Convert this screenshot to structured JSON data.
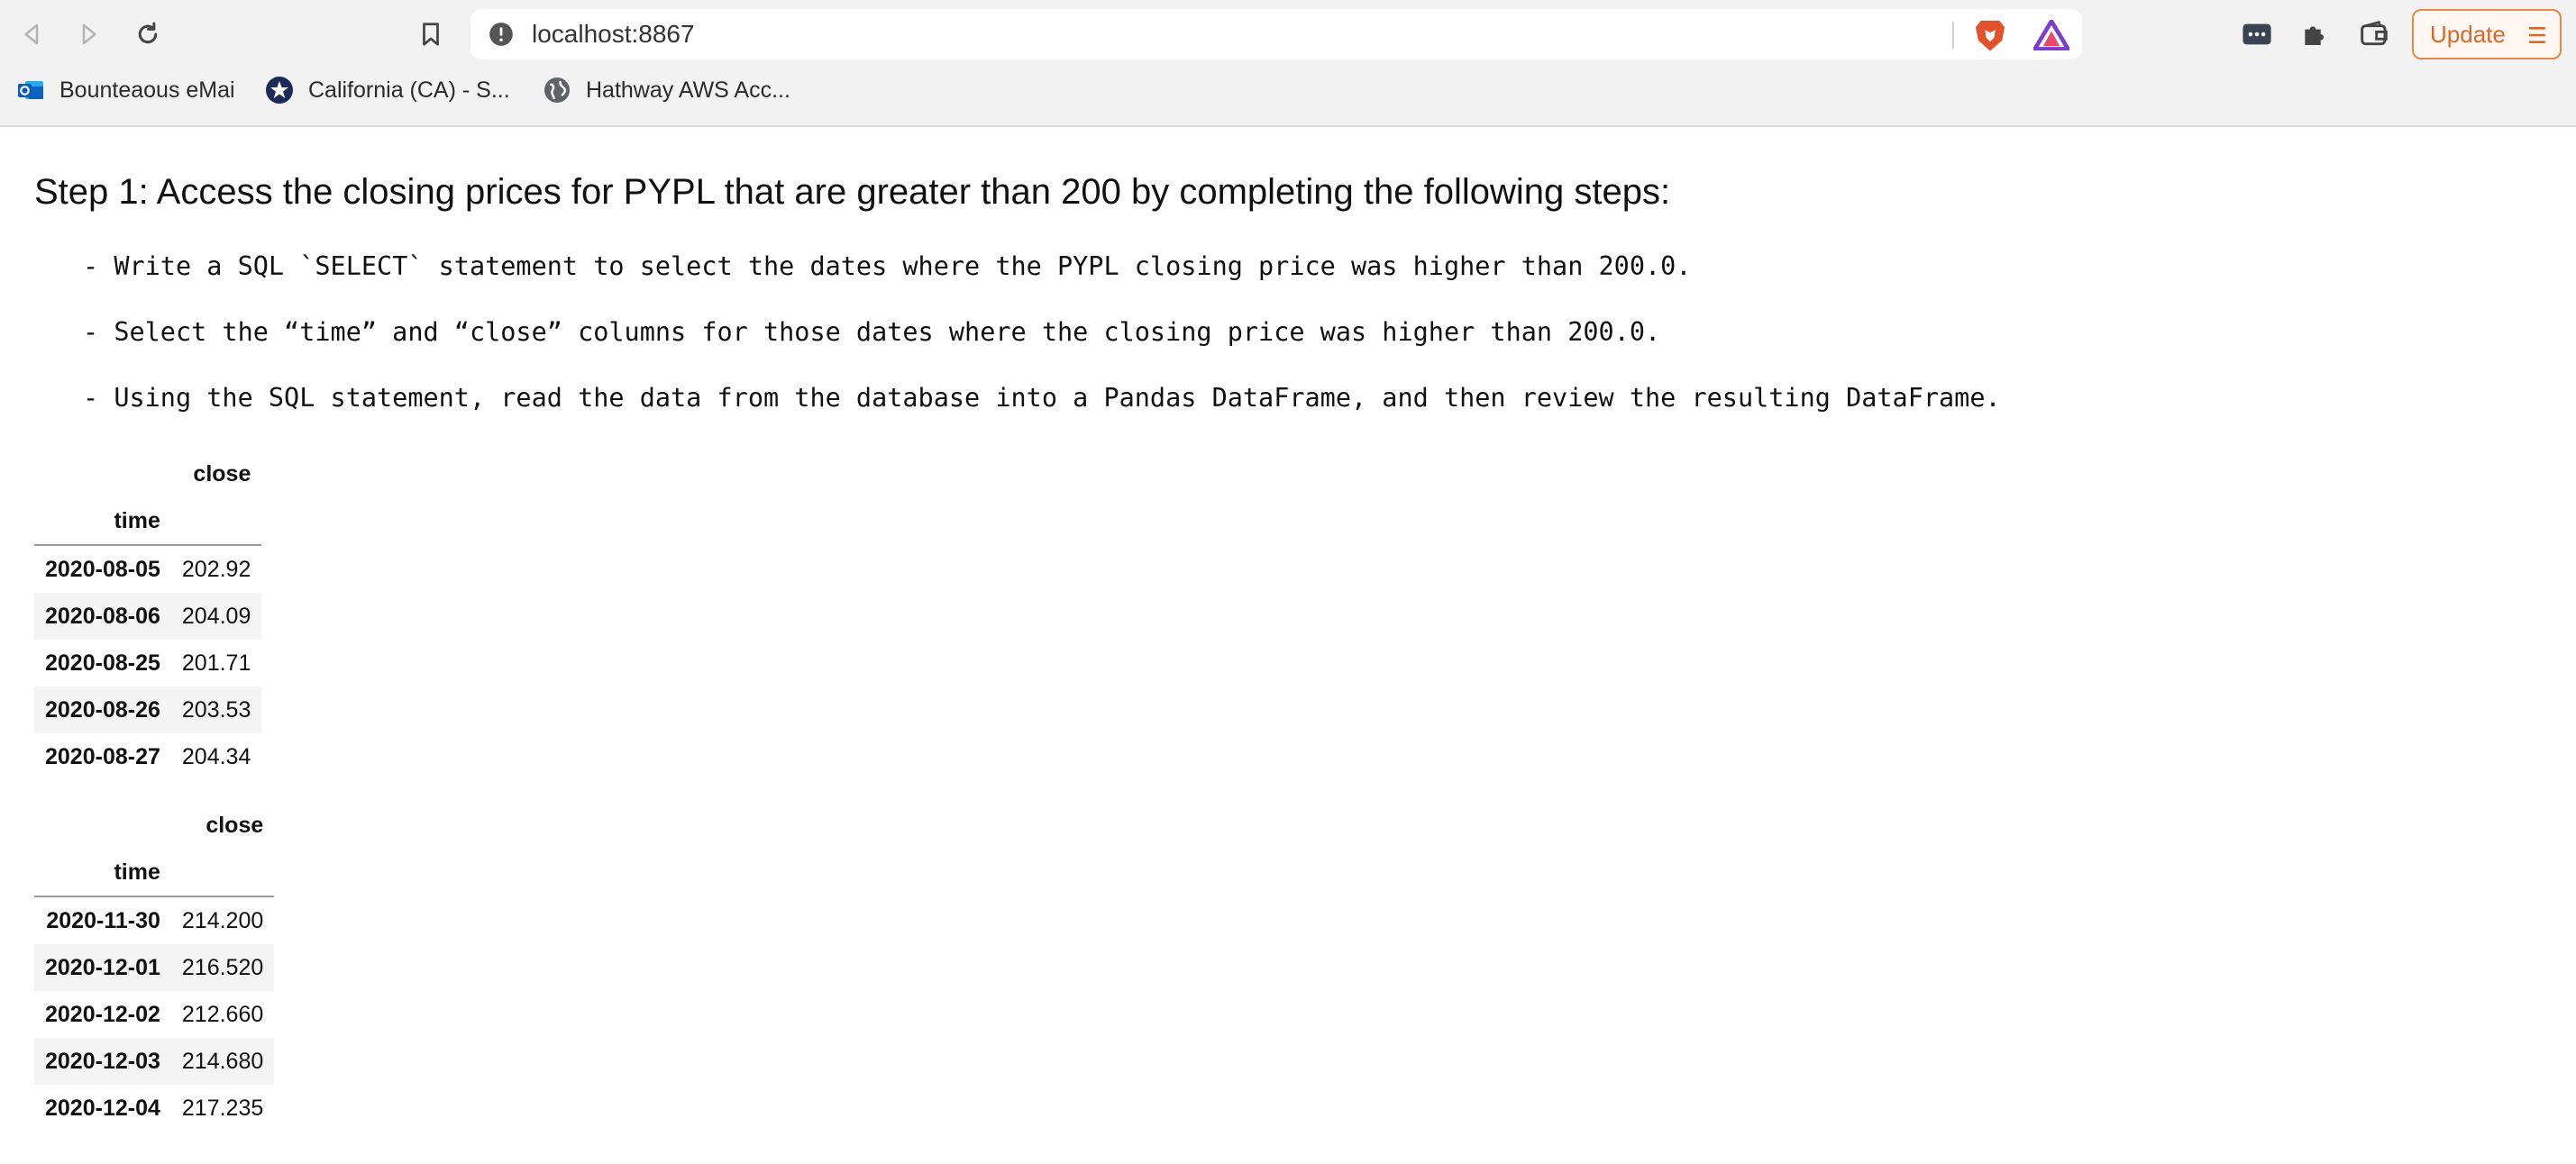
{
  "browser": {
    "url": "localhost:8867",
    "update_label": "Update",
    "bookmarks": [
      {
        "label": "Bounteaous eMai",
        "icon": "outlook-icon"
      },
      {
        "label": "California (CA) - S...",
        "icon": "star-badge-icon"
      },
      {
        "label": "Hathway AWS Acc...",
        "icon": "globe-icon"
      }
    ],
    "colors": {
      "update_accent": "#e8874a",
      "brave": "#e2532d",
      "toolbar_bg": "#f2f2f2"
    }
  },
  "page": {
    "heading": "Step 1: Access the closing prices for PYPL that are greater than 200 by completing the following steps:",
    "instructions": [
      "- Write a SQL `SELECT` statement to select the dates where the PYPL closing price was higher than 200.0.",
      "- Select the “time” and “close” columns for those dates where the closing price was higher than 200.0.",
      "- Using the SQL statement, read the data from the database into a Pandas DataFrame, and then review the resulting DataFrame."
    ],
    "tables": [
      {
        "column_header": "close",
        "index_name": "time",
        "rows": [
          {
            "time": "2020-08-05",
            "close": "202.92"
          },
          {
            "time": "2020-08-06",
            "close": "204.09"
          },
          {
            "time": "2020-08-25",
            "close": "201.71"
          },
          {
            "time": "2020-08-26",
            "close": "203.53"
          },
          {
            "time": "2020-08-27",
            "close": "204.34"
          }
        ]
      },
      {
        "column_header": "close",
        "index_name": "time",
        "rows": [
          {
            "time": "2020-11-30",
            "close": "214.200"
          },
          {
            "time": "2020-12-01",
            "close": "216.520"
          },
          {
            "time": "2020-12-02",
            "close": "212.660"
          },
          {
            "time": "2020-12-03",
            "close": "214.680"
          },
          {
            "time": "2020-12-04",
            "close": "217.235"
          }
        ]
      }
    ]
  }
}
